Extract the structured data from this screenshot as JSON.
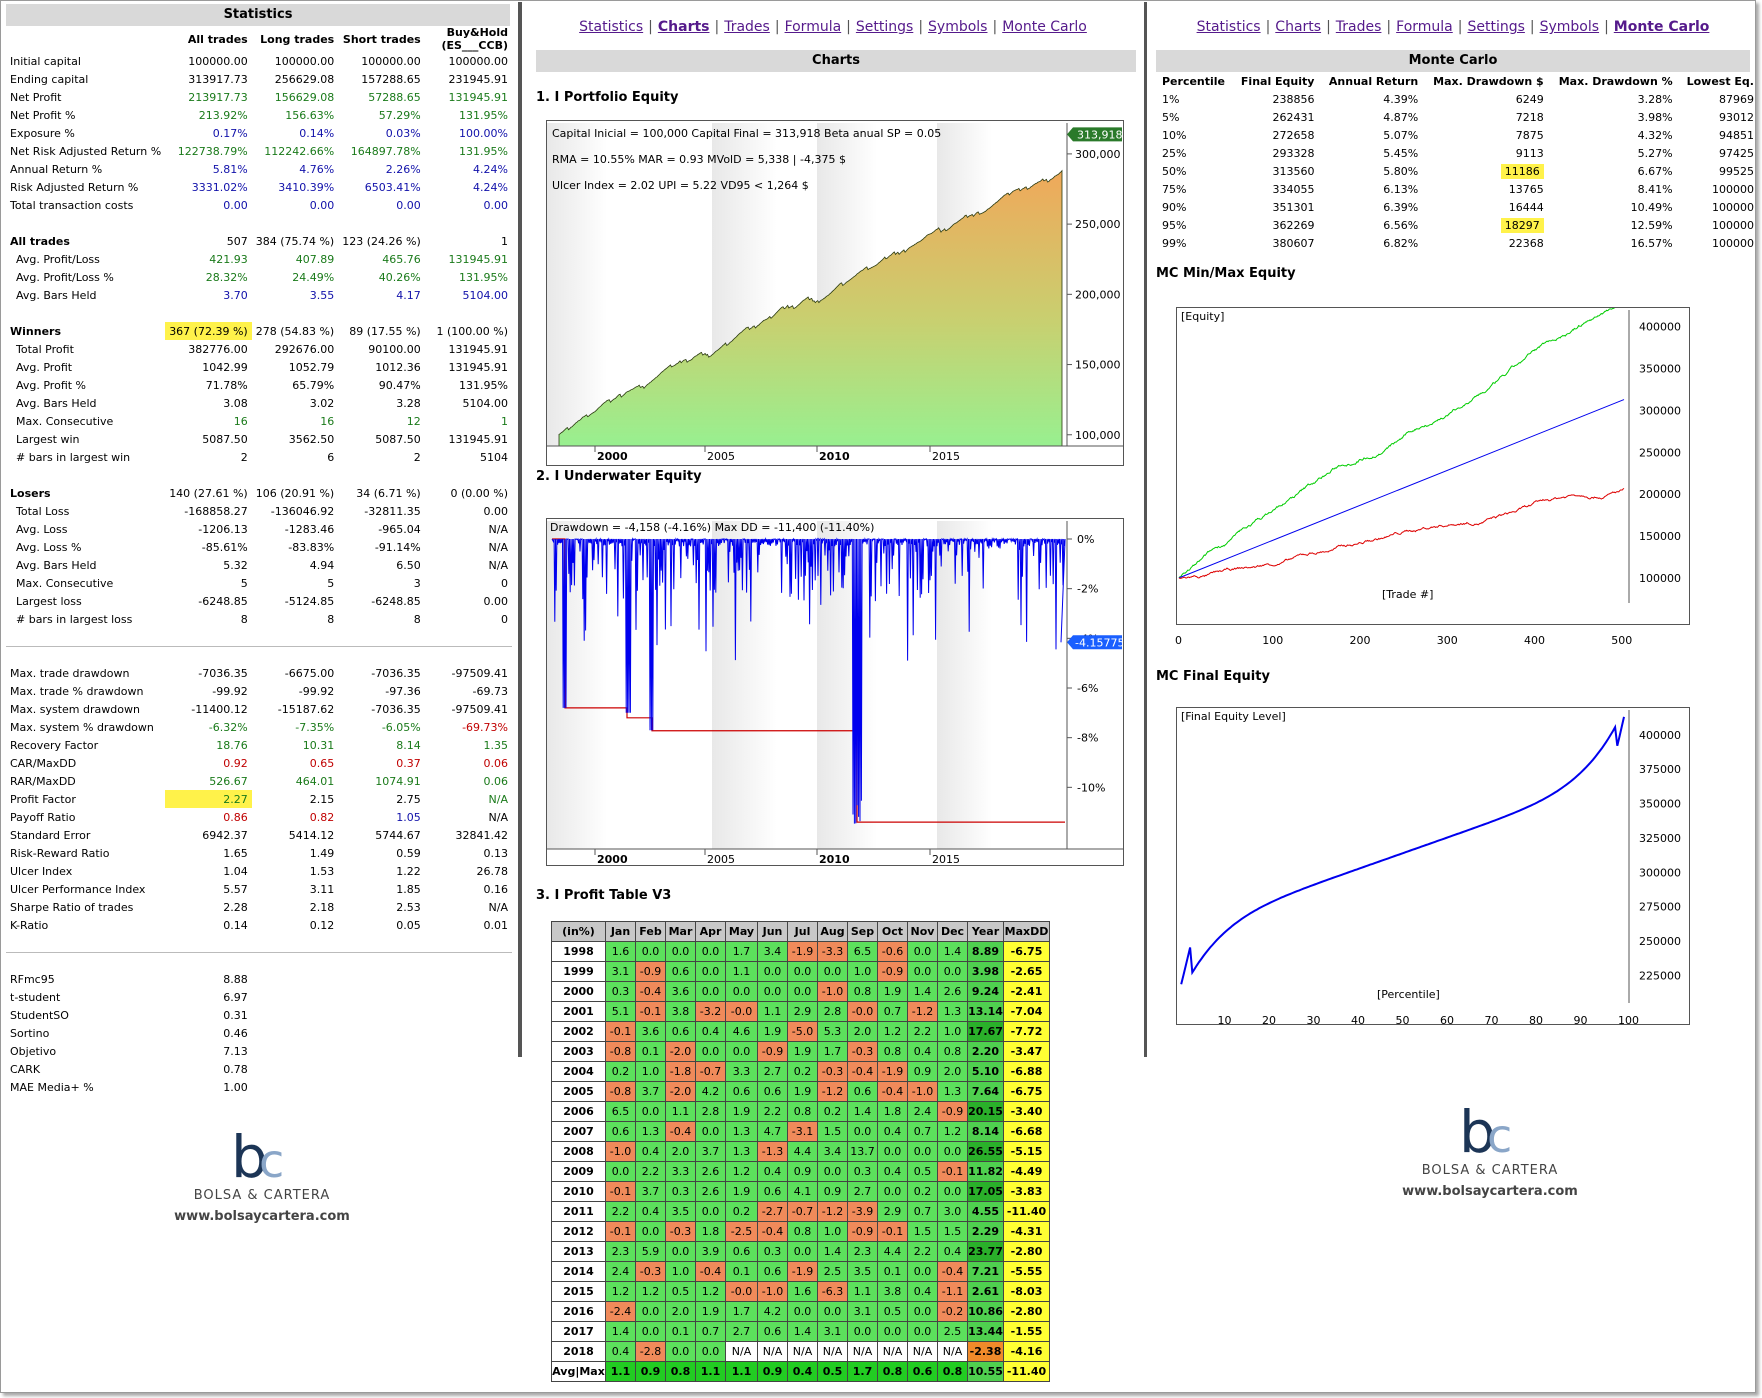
{
  "stats": {
    "title": "Statistics",
    "headers": [
      "",
      "All trades",
      "Long trades",
      "Short trades",
      "Buy&Hold (ES___CCB)"
    ],
    "groups": [
      [
        [
          "Initial capital",
          "100000.00",
          "100000.00",
          "100000.00",
          "100000.00",
          "",
          ""
        ],
        [
          "Ending capital",
          "313917.73",
          "256629.08",
          "157288.65",
          "231945.91",
          "",
          ""
        ],
        [
          "Net Profit",
          "213917.73",
          "156629.08",
          "57288.65",
          "131945.91",
          "g",
          ""
        ],
        [
          "Net Profit %",
          "213.92%",
          "156.63%",
          "57.29%",
          "131.95%",
          "g",
          ""
        ],
        [
          "Exposure %",
          "0.17%",
          "0.14%",
          "0.03%",
          "100.00%",
          "b",
          ""
        ],
        [
          "Net Risk Adjusted Return %",
          "122738.79%",
          "112242.66%",
          "164897.78%",
          "131.95%",
          "g",
          ""
        ],
        [
          "Annual Return %",
          "5.81%",
          "4.76%",
          "2.26%",
          "4.24%",
          "b",
          ""
        ],
        [
          "Risk Adjusted Return %",
          "3331.02%",
          "3410.39%",
          "6503.41%",
          "4.24%",
          "b",
          ""
        ],
        [
          "Total transaction costs",
          "0.00",
          "0.00",
          "0.00",
          "0.00",
          "b",
          ""
        ]
      ],
      [
        [
          "All trades",
          "507",
          "384 (75.74 %)",
          "123 (24.26 %)",
          "1",
          "",
          "h"
        ],
        [
          "Avg. Profit/Loss",
          "421.93",
          "407.89",
          "465.76",
          "131945.91",
          "g",
          "s"
        ],
        [
          "Avg. Profit/Loss %",
          "28.32%",
          "24.49%",
          "40.26%",
          "131.95%",
          "g",
          "s"
        ],
        [
          "Avg. Bars Held",
          "3.70",
          "3.55",
          "4.17",
          "5104.00",
          "b",
          "s"
        ]
      ],
      [
        [
          "Winners",
          "367 (72.39 %)",
          "278 (54.83 %)",
          "89 (17.55 %)",
          "1 (100.00 %)",
          "",
          "hw"
        ],
        [
          "Total Profit",
          "382776.00",
          "292676.00",
          "90100.00",
          "131945.91",
          "",
          "s"
        ],
        [
          "Avg. Profit",
          "1042.99",
          "1052.79",
          "1012.36",
          "131945.91",
          "",
          "s"
        ],
        [
          "Avg. Profit %",
          "71.78%",
          "65.79%",
          "90.47%",
          "131.95%",
          "",
          "s"
        ],
        [
          "Avg. Bars Held",
          "3.08",
          "3.02",
          "3.28",
          "5104.00",
          "",
          "s"
        ],
        [
          "Max. Consecutive",
          "16",
          "16",
          "12",
          "1",
          "g",
          "s"
        ],
        [
          "Largest win",
          "5087.50",
          "3562.50",
          "5087.50",
          "131945.91",
          "",
          "s"
        ],
        [
          "# bars in largest win",
          "2",
          "6",
          "2",
          "5104",
          "",
          "s"
        ]
      ],
      [
        [
          "Losers",
          "140 (27.61 %)",
          "106 (20.91 %)",
          "34 (6.71 %)",
          "0 (0.00 %)",
          "",
          "h"
        ],
        [
          "Total Loss",
          "-168858.27",
          "-136046.92",
          "-32811.35",
          "0.00",
          "",
          "s"
        ],
        [
          "Avg. Loss",
          "-1206.13",
          "-1283.46",
          "-965.04",
          "N/A",
          "",
          "s"
        ],
        [
          "Avg. Loss %",
          "-85.61%",
          "-83.83%",
          "-91.14%",
          "N/A",
          "",
          "s"
        ],
        [
          "Avg. Bars Held",
          "5.32",
          "4.94",
          "6.50",
          "N/A",
          "",
          "s"
        ],
        [
          "Max. Consecutive",
          "5",
          "5",
          "3",
          "0",
          "",
          "s"
        ],
        [
          "Largest loss",
          "-6248.85",
          "-5124.85",
          "-6248.85",
          "0.00",
          "",
          "s"
        ],
        [
          "# bars in largest loss",
          "8",
          "8",
          "8",
          "0",
          "",
          "s"
        ]
      ],
      [
        [
          "Max. trade drawdown",
          "-7036.35",
          "-6675.00",
          "-7036.35",
          "-97509.41",
          "",
          ""
        ],
        [
          "Max. trade % drawdown",
          "-99.92",
          "-99.92",
          "-97.36",
          "-69.73",
          "",
          ""
        ],
        [
          "Max. system drawdown",
          "-11400.12",
          "-15187.62",
          "-7036.35",
          "-97509.41",
          "",
          ""
        ],
        [
          "Max. system % drawdown",
          "-6.32%",
          "-7.35%",
          "-6.05%",
          "-69.73%",
          "g",
          ""
        ],
        [
          "Recovery Factor",
          "18.76",
          "10.31",
          "8.14",
          "1.35",
          "g",
          ""
        ],
        [
          "CAR/MaxDD",
          "0.92",
          "0.65",
          "0.37",
          "0.06",
          "r",
          ""
        ],
        [
          "RAR/MaxDD",
          "526.67",
          "464.01",
          "1074.91",
          "0.06",
          "g",
          ""
        ],
        [
          "Profit Factor",
          "2.27",
          "2.15",
          "2.75",
          "N/A",
          "g",
          "pf"
        ],
        [
          "Payoff Ratio",
          "0.86",
          "0.82",
          "1.05",
          "N/A",
          "r",
          ""
        ],
        [
          "Standard Error",
          "6942.37",
          "5414.12",
          "5744.67",
          "32841.42",
          "",
          ""
        ],
        [
          "Risk-Reward Ratio",
          "1.65",
          "1.49",
          "0.59",
          "0.13",
          "",
          ""
        ],
        [
          "Ulcer Index",
          "1.04",
          "1.53",
          "1.22",
          "26.78",
          "",
          ""
        ],
        [
          "Ulcer Performance Index",
          "5.57",
          "3.11",
          "1.85",
          "0.16",
          "",
          ""
        ],
        [
          "Sharpe Ratio of trades",
          "2.28",
          "2.18",
          "2.53",
          "N/A",
          "",
          ""
        ],
        [
          "K-Ratio",
          "0.14",
          "0.12",
          "0.05",
          "0.01",
          "",
          ""
        ]
      ],
      [
        [
          "RFmc95",
          "8.88",
          "",
          "",
          "",
          "",
          ""
        ],
        [
          "t-student",
          "6.97",
          "",
          "",
          "",
          "",
          ""
        ],
        [
          "StudentSO",
          "0.31",
          "",
          "",
          "",
          "",
          ""
        ],
        [
          "Sortino",
          "0.46",
          "",
          "",
          "",
          "",
          ""
        ],
        [
          "Objetivo",
          "7.13",
          "",
          "",
          "",
          "",
          ""
        ],
        [
          "CARK",
          "0.78",
          "",
          "",
          "",
          "",
          ""
        ],
        [
          "MAE Media+ %",
          "1.00",
          "",
          "",
          "",
          "",
          ""
        ]
      ]
    ]
  },
  "nav": [
    "Statistics",
    "Charts",
    "Trades",
    "Formula",
    "Settings",
    "Symbols",
    "Monte Carlo"
  ],
  "charts": {
    "title": "Charts",
    "s1": "1. I Portfolio Equity",
    "eq_line1": "Capital Inicial = 100,000  Capital Final = 313,918  Beta anual SP = 0.05",
    "eq_line2": "RMA = 10.55%  MAR = 0.93  MVolD = 5,338 | -4,375 $",
    "eq_line3": "Ulcer Index = 2.02  UPI = 5.22  VD95 < 1,264 $",
    "eq_last": "313,918",
    "eq_yticks": [
      "300,000",
      "250,000",
      "200,000",
      "150,000",
      "100,000"
    ],
    "xticks": [
      "2000",
      "2005",
      "2010",
      "2015"
    ],
    "s2": "2. I Underwater Equity",
    "uw_label": "Drawdown = -4,158 (-4.16%)     Max DD = -11,400 (-11.40%)",
    "uw_last": "-4.15775",
    "uw_yticks": [
      "0%",
      "-2%",
      "-4%",
      "-6%",
      "-8%",
      "-10%"
    ],
    "s3": "3. I Profit Table V3"
  },
  "profit_table": {
    "headers": [
      "(in%)",
      "Jan",
      "Feb",
      "Mar",
      "Apr",
      "May",
      "Jun",
      "Jul",
      "Aug",
      "Sep",
      "Oct",
      "Nov",
      "Dec",
      "Year",
      "MaxDD"
    ],
    "rows": [
      [
        "1998",
        "1.6",
        "0.0",
        "0.0",
        "0.0",
        "1.7",
        "3.4",
        "-1.9",
        "-3.3",
        "6.5",
        "-0.6",
        "0.0",
        "1.4",
        "8.89",
        "-6.75"
      ],
      [
        "1999",
        "3.1",
        "-0.9",
        "0.6",
        "0.0",
        "1.1",
        "0.0",
        "0.0",
        "0.0",
        "1.0",
        "-0.9",
        "0.0",
        "0.0",
        "3.98",
        "-2.65"
      ],
      [
        "2000",
        "0.3",
        "-0.4",
        "3.6",
        "0.0",
        "0.0",
        "0.0",
        "0.0",
        "-1.0",
        "0.8",
        "1.9",
        "1.4",
        "2.6",
        "9.24",
        "-2.41"
      ],
      [
        "2001",
        "5.1",
        "-0.1",
        "3.8",
        "-3.2",
        "-0.0",
        "1.1",
        "2.9",
        "2.8",
        "-0.0",
        "0.7",
        "-1.2",
        "1.3",
        "13.14",
        "-7.04"
      ],
      [
        "2002",
        "-0.1",
        "3.6",
        "0.6",
        "0.4",
        "4.6",
        "1.9",
        "-5.0",
        "5.3",
        "2.0",
        "1.2",
        "2.2",
        "1.0",
        "17.67",
        "-7.72"
      ],
      [
        "2003",
        "-0.8",
        "0.1",
        "-2.0",
        "0.0",
        "0.0",
        "-0.9",
        "1.9",
        "1.7",
        "-0.3",
        "0.8",
        "0.4",
        "0.8",
        "2.20",
        "-3.47"
      ],
      [
        "2004",
        "0.2",
        "1.0",
        "-1.8",
        "-0.7",
        "3.3",
        "2.7",
        "0.2",
        "-0.3",
        "-0.4",
        "-1.9",
        "0.9",
        "2.0",
        "5.10",
        "-6.88"
      ],
      [
        "2005",
        "-0.8",
        "3.7",
        "-2.0",
        "4.2",
        "0.6",
        "0.6",
        "1.9",
        "-1.2",
        "0.6",
        "-0.4",
        "-1.0",
        "1.3",
        "7.64",
        "-6.75"
      ],
      [
        "2006",
        "6.5",
        "0.0",
        "1.1",
        "2.8",
        "1.9",
        "2.2",
        "0.8",
        "0.2",
        "1.4",
        "1.8",
        "2.4",
        "-0.9",
        "20.15",
        "-3.40"
      ],
      [
        "2007",
        "0.6",
        "1.3",
        "-0.4",
        "0.0",
        "1.3",
        "4.7",
        "-3.1",
        "1.5",
        "0.0",
        "0.4",
        "0.7",
        "1.2",
        "8.14",
        "-6.68"
      ],
      [
        "2008",
        "-1.0",
        "0.4",
        "2.0",
        "3.7",
        "1.3",
        "-1.3",
        "4.4",
        "3.4",
        "13.7",
        "0.0",
        "0.0",
        "0.0",
        "26.55",
        "-5.15"
      ],
      [
        "2009",
        "0.0",
        "2.2",
        "3.3",
        "2.6",
        "1.2",
        "0.4",
        "0.9",
        "0.0",
        "0.3",
        "0.4",
        "0.5",
        "-0.1",
        "11.82",
        "-4.49"
      ],
      [
        "2010",
        "-0.1",
        "3.7",
        "0.3",
        "2.6",
        "1.9",
        "0.6",
        "4.1",
        "0.9",
        "2.7",
        "0.0",
        "0.2",
        "0.0",
        "17.05",
        "-3.83"
      ],
      [
        "2011",
        "2.2",
        "0.4",
        "3.5",
        "0.0",
        "0.2",
        "-2.7",
        "-0.7",
        "-1.2",
        "-3.9",
        "2.9",
        "0.7",
        "3.0",
        "4.55",
        "-11.40"
      ],
      [
        "2012",
        "-0.1",
        "0.0",
        "-0.3",
        "1.8",
        "-2.5",
        "-0.4",
        "0.8",
        "1.0",
        "-0.9",
        "-0.1",
        "1.5",
        "1.5",
        "2.29",
        "-4.31"
      ],
      [
        "2013",
        "2.3",
        "5.9",
        "0.0",
        "3.9",
        "0.6",
        "0.3",
        "0.0",
        "1.4",
        "2.3",
        "4.4",
        "2.2",
        "0.4",
        "23.77",
        "-2.80"
      ],
      [
        "2014",
        "2.4",
        "-0.3",
        "1.0",
        "-0.4",
        "0.1",
        "0.6",
        "-1.9",
        "2.5",
        "3.5",
        "0.1",
        "0.0",
        "-0.4",
        "7.21",
        "-5.55"
      ],
      [
        "2015",
        "1.2",
        "1.2",
        "0.5",
        "1.2",
        "-0.0",
        "-1.0",
        "1.6",
        "-6.3",
        "1.1",
        "3.8",
        "0.4",
        "-1.1",
        "2.61",
        "-8.03"
      ],
      [
        "2016",
        "-2.4",
        "0.0",
        "2.0",
        "1.9",
        "1.7",
        "4.2",
        "0.0",
        "0.0",
        "3.1",
        "0.5",
        "0.0",
        "-0.2",
        "10.86",
        "-2.80"
      ],
      [
        "2017",
        "1.4",
        "0.0",
        "0.1",
        "0.7",
        "2.7",
        "0.6",
        "1.4",
        "3.1",
        "0.0",
        "0.0",
        "0.0",
        "2.5",
        "13.44",
        "-1.55"
      ],
      [
        "2018",
        "0.4",
        "-2.8",
        "0.0",
        "0.0",
        "N/A",
        "N/A",
        "N/A",
        "N/A",
        "N/A",
        "N/A",
        "N/A",
        "N/A",
        "-2.38",
        "-4.16"
      ],
      [
        "Avg|Max",
        "1.1",
        "0.9",
        "0.8",
        "1.1",
        "1.1",
        "0.9",
        "0.4",
        "0.5",
        "1.7",
        "0.8",
        "0.6",
        "0.8",
        "10.55",
        "-11.40"
      ]
    ]
  },
  "monte_carlo": {
    "title": "Monte Carlo",
    "headers": [
      "Percentile",
      "Final Equity",
      "Annual Return",
      "Max. Drawdown $",
      "Max. Drawdown %",
      "Lowest Eq."
    ],
    "rows": [
      [
        "1%",
        "238856",
        "4.39%",
        "6249",
        "3.28%",
        "87969"
      ],
      [
        "5%",
        "262431",
        "4.87%",
        "7218",
        "3.98%",
        "93012"
      ],
      [
        "10%",
        "272658",
        "5.07%",
        "7875",
        "4.32%",
        "94851"
      ],
      [
        "25%",
        "293328",
        "5.45%",
        "9113",
        "5.27%",
        "97425"
      ],
      [
        "50%",
        "313560",
        "5.80%",
        "11186",
        "6.67%",
        "99525"
      ],
      [
        "75%",
        "334055",
        "6.13%",
        "13765",
        "8.41%",
        "100000"
      ],
      [
        "90%",
        "351301",
        "6.39%",
        "16444",
        "10.49%",
        "100000"
      ],
      [
        "95%",
        "362269",
        "6.56%",
        "18297",
        "12.59%",
        "100000"
      ],
      [
        "99%",
        "380607",
        "6.82%",
        "22368",
        "16.57%",
        "100000"
      ]
    ],
    "minmax_title": "MC Min/Max Equity",
    "minmax_label": "[Equity]",
    "minmax_xlabel": "[Trade #]",
    "minmax_yticks": [
      "400000",
      "350000",
      "300000",
      "250000",
      "200000",
      "150000",
      "100000"
    ],
    "minmax_xticks": [
      "0",
      "100",
      "200",
      "300",
      "400",
      "500"
    ],
    "final_title": "MC Final Equity",
    "final_label": "[Final Equity Level]",
    "final_xlabel": "[Percentile]",
    "final_yticks": [
      "400000",
      "375000",
      "350000",
      "325000",
      "300000",
      "275000",
      "250000",
      "225000"
    ],
    "final_xticks": [
      "10",
      "20",
      "30",
      "40",
      "50",
      "60",
      "70",
      "80",
      "90",
      "100"
    ]
  },
  "logo": {
    "letters": "bc",
    "text": "BOLSA & CARTERA",
    "url": "www.bolsaycartera.com"
  }
}
